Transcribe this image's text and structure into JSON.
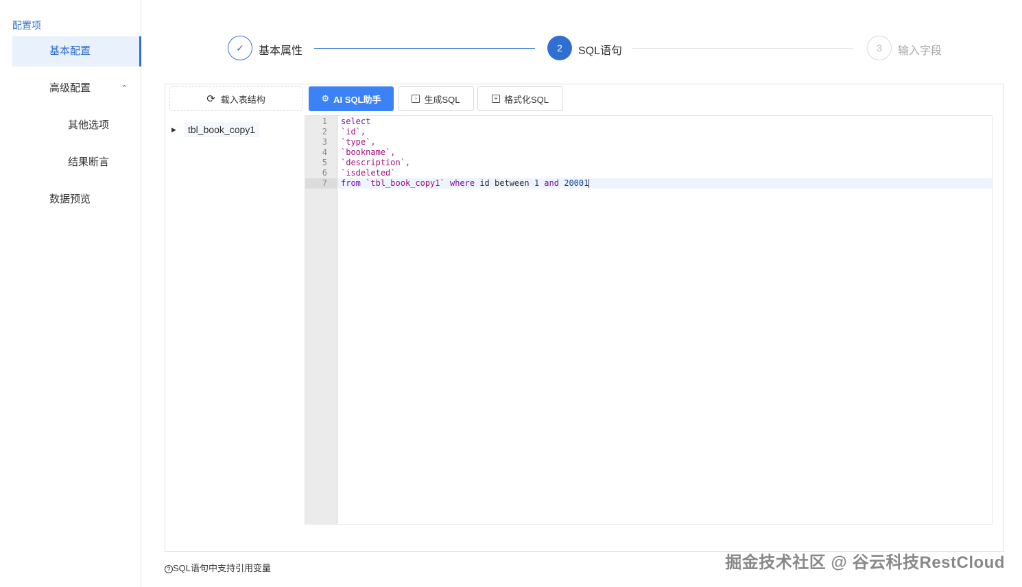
{
  "sidebar": {
    "title": "配置项",
    "items": [
      {
        "label": "基本配置",
        "active": true
      },
      {
        "label": "高级配置",
        "caret": "⌃"
      },
      {
        "label": "其他选项"
      },
      {
        "label": "结果断言"
      },
      {
        "label": "数据预览"
      }
    ]
  },
  "steps": [
    {
      "label": "基本属性",
      "icon": "✓",
      "status": "done"
    },
    {
      "label": "SQL语句",
      "icon": "2",
      "status": "active"
    },
    {
      "label": "输入字段",
      "icon": "3",
      "status": "wait"
    }
  ],
  "tree": {
    "load_label": "载入表结构",
    "node_label": "tbl_book_copy1"
  },
  "toolbar": {
    "ai_label": "AI SQL助手",
    "generate_label": "生成SQL",
    "format_label": "格式化SQL"
  },
  "editor": {
    "line_numbers": [
      "1",
      "2",
      "3",
      "4",
      "5",
      "6",
      "7"
    ],
    "lines": {
      "l1": "select",
      "l2": "`id`,",
      "l3": "`type`,",
      "l4": "`bookname`,",
      "l5": "`description`,",
      "l6": "`isdeleted`",
      "l7_from": "from",
      "l7_table": "`tbl_book_copy1`",
      "l7_where": "where",
      "l7_id": "id",
      "l7_between": "between",
      "l7_num1": "1",
      "l7_and": "and",
      "l7_num2": "20001"
    },
    "active_line": 7
  },
  "footer": {
    "note": "SQL语句中支持引用变量",
    "help_icon": "?"
  },
  "watermark": "掘金技术社区 @ 谷云科技RestCloud",
  "colors": {
    "accent": "#2f6fd3",
    "primary_button": "#3b82f6",
    "keyword": "#7a0da8"
  }
}
